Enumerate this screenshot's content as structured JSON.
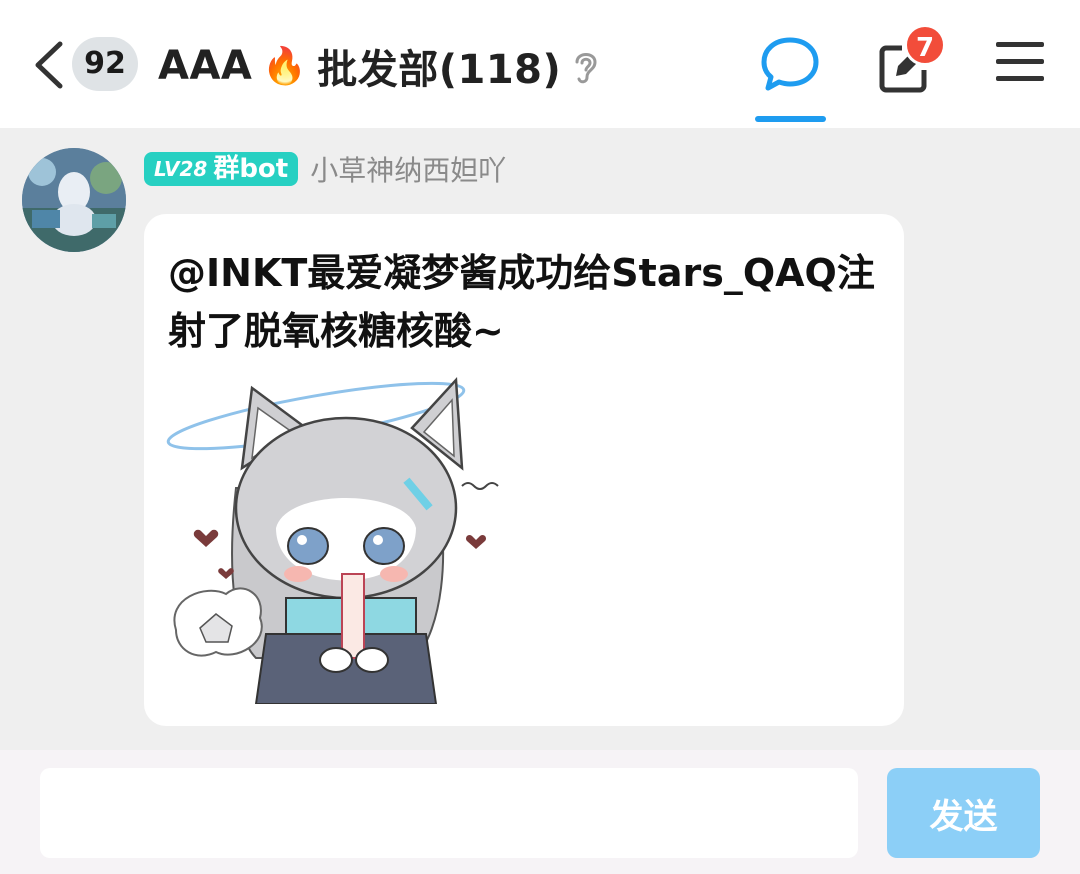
{
  "header": {
    "unread_count": "92",
    "group_name_prefix": "AAA",
    "flame_emoji": "🔥",
    "group_name_suffix": "批发部(118)",
    "notification_badge": "7",
    "accent_color": "#1e9cf0",
    "badge_color": "#f24d3a"
  },
  "message": {
    "level_label": "LV28",
    "role_label": "群bot",
    "sender_name": "小草神纳西妲吖",
    "text": "@INKT最爱凝梦酱成功给Stars_QAQ注射了脱氧核糖核酸~",
    "tag_color": "#27d0c2"
  },
  "composer": {
    "input_value": "",
    "send_label": "发送",
    "send_color": "#8ccff7"
  }
}
